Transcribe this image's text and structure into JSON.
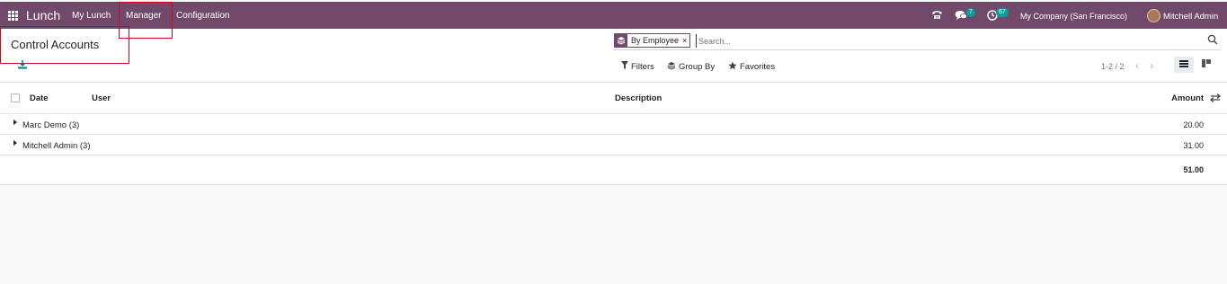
{
  "navbar": {
    "app_name": "Lunch",
    "menu": [
      "My Lunch",
      "Manager",
      "Configuration"
    ],
    "messages_badge": "7",
    "activities_badge": "67",
    "company": "My Company (San Francisco)",
    "user": "Mitchell Admin"
  },
  "control_panel": {
    "title": "Control Accounts",
    "search": {
      "facet_label": "By Employee",
      "facet_close": "×",
      "placeholder": "Search..."
    },
    "filters_label": "Filters",
    "group_by_label": "Group By",
    "favorites_label": "Favorites",
    "pager": "1-2 / 2"
  },
  "list": {
    "columns": [
      "Date",
      "User",
      "Description",
      "Amount"
    ],
    "groups": [
      {
        "name": "Marc Demo (3)",
        "amount": "20.00"
      },
      {
        "name": "Mitchell Admin (3)",
        "amount": "31.00"
      }
    ],
    "total": "51.00"
  },
  "colors": {
    "brand": "#71496a",
    "badge": "#00a09d",
    "highlight_box": "#d9001b"
  }
}
